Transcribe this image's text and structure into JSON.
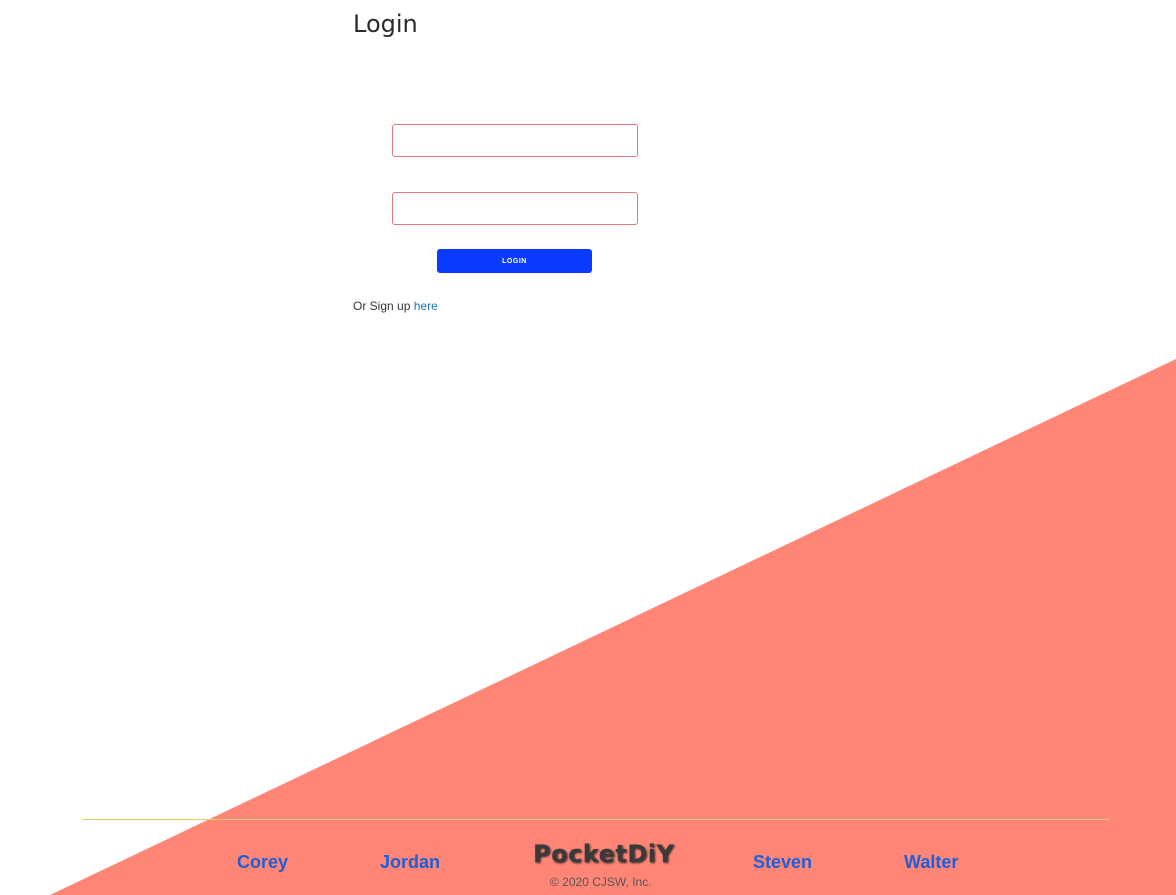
{
  "login": {
    "title": "Login",
    "username": {
      "value": "",
      "placeholder": ""
    },
    "password": {
      "value": "",
      "placeholder": ""
    },
    "login_button_label": "LOGIN",
    "signup_prefix": "Or Sign up",
    "signup_link_label": "here"
  },
  "footer": {
    "links": [
      "Corey",
      "Jordan",
      "Steven",
      "Walter"
    ],
    "brand": "PocketDiY",
    "copyright": "© 2020 CJSW, Inc."
  },
  "colors": {
    "accent_triangle": "#ff8676",
    "button": "#0a3cff",
    "field_border": "#e27a7f",
    "link": "#1f5ed6",
    "footer_divider": "#f0c87a"
  }
}
